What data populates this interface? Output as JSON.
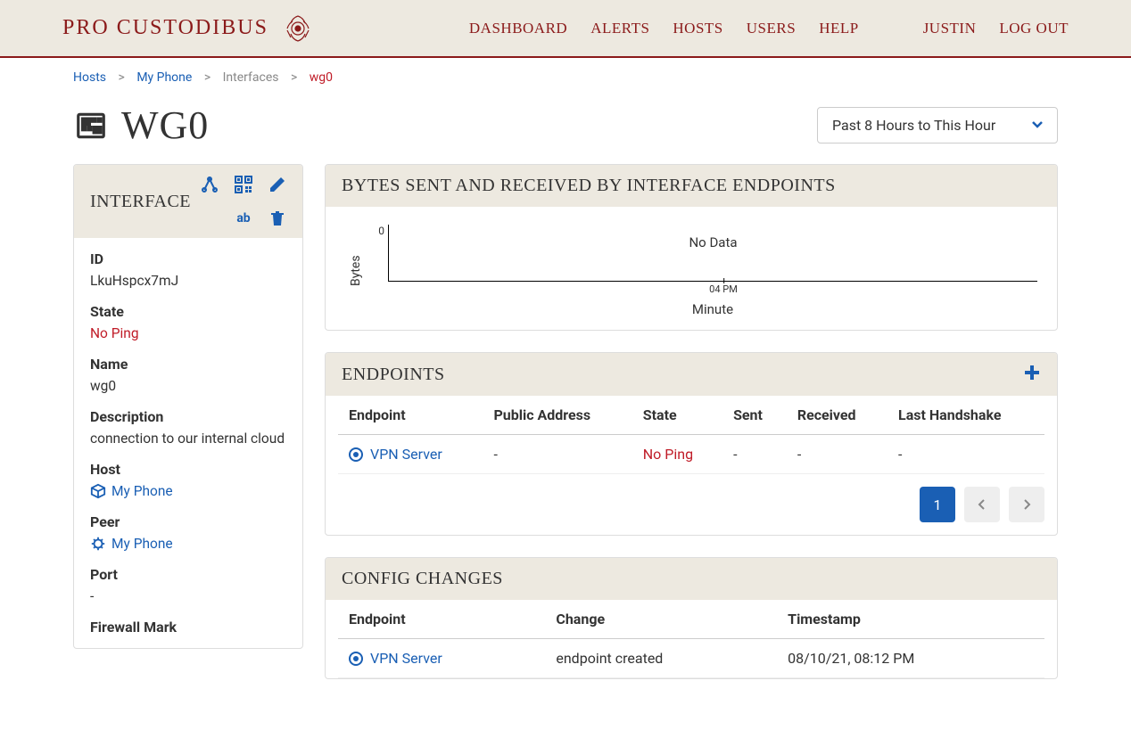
{
  "brand": "PRO CUSTODIBUS",
  "nav": {
    "dashboard": "DASHBOARD",
    "alerts": "ALERTS",
    "hosts": "HOSTS",
    "users": "USERS",
    "help": "HELP",
    "username": "JUSTIN",
    "logout": "LOG OUT"
  },
  "breadcrumb": {
    "hosts": "Hosts",
    "myphone": "My Phone",
    "interfaces": "Interfaces",
    "current": "wg0"
  },
  "page_title": "WG0",
  "time_range": {
    "label": "Past 8 Hours to This Hour"
  },
  "interface_panel": {
    "title": "INTERFACE",
    "fields": {
      "id_label": "ID",
      "id_value": "LkuHspcx7mJ",
      "state_label": "State",
      "state_value": "No Ping",
      "name_label": "Name",
      "name_value": "wg0",
      "desc_label": "Description",
      "desc_value": "connection to our internal cloud",
      "host_label": "Host",
      "host_value": "My Phone",
      "peer_label": "Peer",
      "peer_value": "My Phone",
      "port_label": "Port",
      "port_value": "-",
      "fwmark_label": "Firewall Mark"
    }
  },
  "chart_panel": {
    "title": "BYTES SENT AND RECEIVED BY INTERFACE ENDPOINTS"
  },
  "chart_data": {
    "type": "line",
    "title": "",
    "ylabel": "Bytes",
    "xlabel": "Minute",
    "ylim": [
      0,
      0
    ],
    "yticks": [
      "0"
    ],
    "xticks": [
      "04 PM"
    ],
    "no_data_label": "No Data",
    "series": []
  },
  "endpoints_panel": {
    "title": "ENDPOINTS",
    "columns": {
      "endpoint": "Endpoint",
      "public_address": "Public Address",
      "state": "State",
      "sent": "Sent",
      "received": "Received",
      "last_handshake": "Last Handshake"
    },
    "rows": [
      {
        "endpoint": "VPN Server",
        "public_address": "-",
        "state": "No Ping",
        "sent": "-",
        "received": "-",
        "last_handshake": "-"
      }
    ],
    "pager": {
      "current": "1"
    }
  },
  "config_panel": {
    "title": "CONFIG CHANGES",
    "columns": {
      "endpoint": "Endpoint",
      "change": "Change",
      "timestamp": "Timestamp"
    },
    "rows": [
      {
        "endpoint": "VPN Server",
        "change": "endpoint created",
        "timestamp": "08/10/21, 08:12 PM"
      }
    ]
  }
}
